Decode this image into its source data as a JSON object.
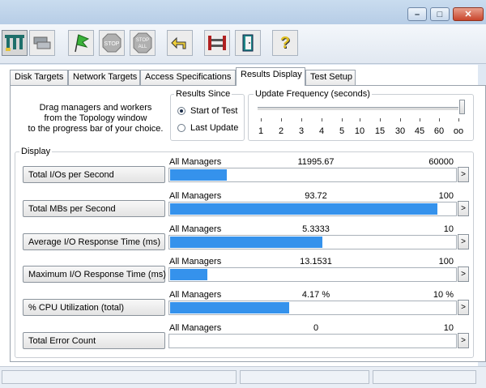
{
  "window": {
    "controls": {
      "minimize": "–",
      "maximize": "□",
      "close": "✕"
    }
  },
  "toolbar": {
    "buttons": [
      {
        "icon": "topology-icon"
      },
      {
        "icon": "disk-workers-icon"
      },
      {
        "icon": "start-flag-icon"
      },
      {
        "icon": "stop-icon",
        "label": "STOP"
      },
      {
        "icon": "stop-all-icon",
        "label": "STOP ALL"
      },
      {
        "icon": "reset-icon"
      },
      {
        "icon": "network-workers-icon"
      },
      {
        "icon": "exit-icon"
      },
      {
        "icon": "help-icon",
        "label": "?"
      }
    ]
  },
  "tabs": [
    "Disk Targets",
    "Network Targets",
    "Access Specifications",
    "Results Display",
    "Test Setup"
  ],
  "active_tab": "Results Display",
  "instructions": [
    "Drag managers and workers",
    "from the Topology window",
    "to the progress bar of your choice."
  ],
  "results_since": {
    "legend": "Results Since",
    "options": [
      "Start of Test",
      "Last Update"
    ],
    "selected": "Start of Test"
  },
  "update_frequency": {
    "legend": "Update Frequency (seconds)",
    "ticks": [
      "1",
      "2",
      "3",
      "4",
      "5",
      "10",
      "15",
      "30",
      "45",
      "60",
      "oo"
    ],
    "selected_index": 10
  },
  "display": {
    "legend": "Display",
    "metrics": [
      {
        "label": "Total I/Os per Second",
        "source": "All Managers",
        "value": "11995.67",
        "max": "60000",
        "fraction": 0.1999
      },
      {
        "label": "Total MBs per Second",
        "source": "All Managers",
        "value": "93.72",
        "max": "100",
        "fraction": 0.9372
      },
      {
        "label": "Average I/O Response Time (ms)",
        "source": "All Managers",
        "value": "5.3333",
        "max": "10",
        "fraction": 0.5333
      },
      {
        "label": "Maximum I/O Response Time (ms)",
        "source": "All Managers",
        "value": "13.1531",
        "max": "100",
        "fraction": 0.1315
      },
      {
        "label": "% CPU Utilization (total)",
        "source": "All Managers",
        "value": "4.17 %",
        "max": "10 %",
        "fraction": 0.417
      },
      {
        "label": "Total Error Count",
        "source": "All Managers",
        "value": "0",
        "max": "10",
        "fraction": 0
      }
    ],
    "arrow": ">"
  },
  "colors": {
    "bar": "#3592ec",
    "accent": "#c9452b"
  }
}
